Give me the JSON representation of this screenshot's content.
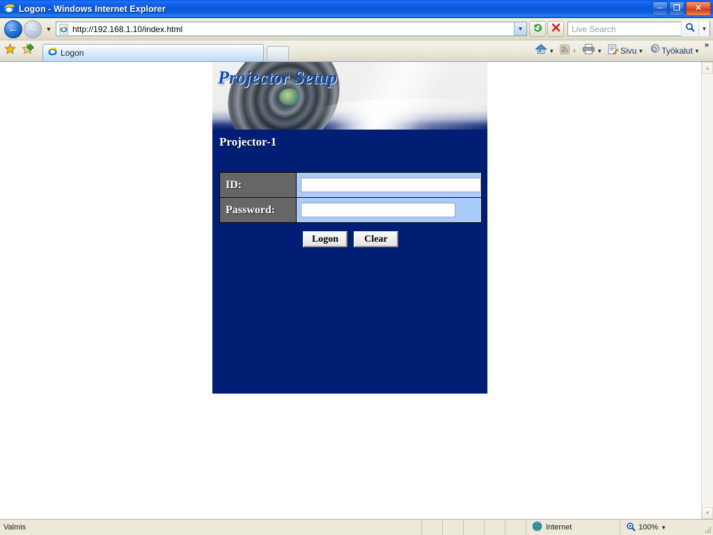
{
  "window": {
    "title": "Logon - Windows Internet Explorer",
    "minimize_label": "Minimize",
    "restore_label": "Restore",
    "close_label": "Close"
  },
  "navigation": {
    "back_label": "Back",
    "forward_label": "Forward",
    "history_label": "Recent Pages",
    "url": "http://192.168.1.10/index.html",
    "refresh_label": "Refresh",
    "stop_label": "Stop"
  },
  "search": {
    "placeholder": "Live Search",
    "go_label": "Search",
    "options_label": "Search Options"
  },
  "favorites": {
    "center_label": "Favorites Center",
    "add_label": "Add to Favorites"
  },
  "tabs": [
    {
      "label": "Logon"
    }
  ],
  "new_tab_label": "New Tab",
  "toolbar": {
    "home_label": "Home",
    "feeds_label": "Feeds",
    "print_label": "Print",
    "page_label": "Sivu",
    "tools_label": "Työkalut",
    "overflow_label": "»"
  },
  "page": {
    "banner_title": "Projector Setup",
    "device_name": "Projector-1",
    "form": {
      "id_label": "ID:",
      "id_value": "",
      "password_label": "Password:",
      "password_value": "",
      "logon_button": "Logon",
      "clear_button": "Clear"
    }
  },
  "statusbar": {
    "status": "Valmis",
    "zone": "Internet",
    "zoom": "100%"
  },
  "colors": {
    "title_bar_blue": "#0c5cdd",
    "page_navy": "#001e73",
    "banner_text_blue": "#0b4bb5",
    "label_gray": "#666666",
    "input_cell_blue": "#a9ccfa",
    "status_bg": "#ece9d8"
  }
}
